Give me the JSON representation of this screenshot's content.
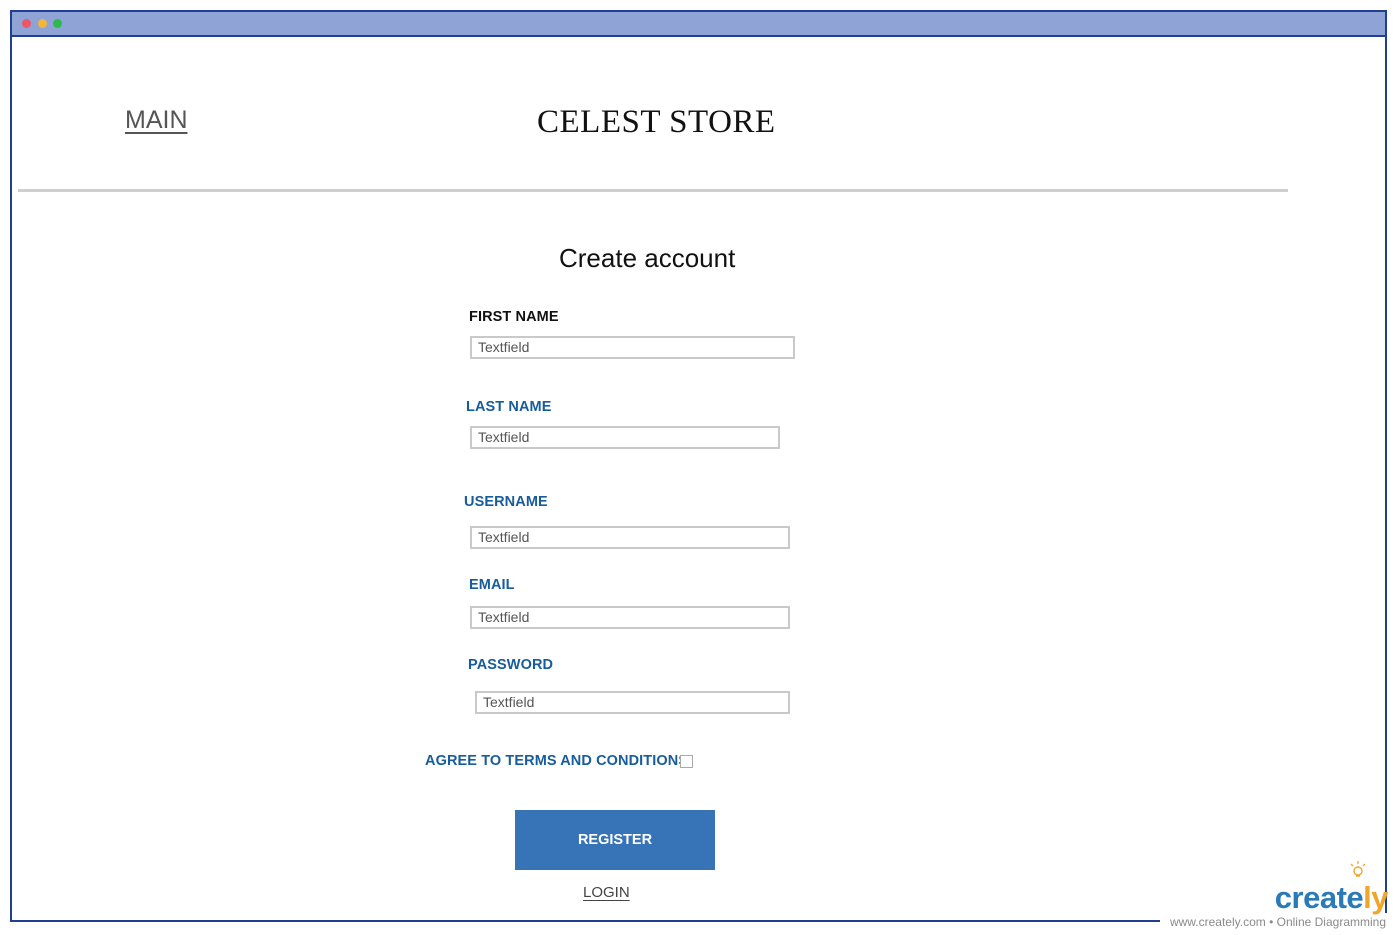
{
  "window": {
    "traffic_lights": {
      "close": "#ee5566",
      "minimize": "#f2b73a",
      "maximize": "#2db94d"
    }
  },
  "header": {
    "main_link": "MAIN",
    "store_title": "CELEST STORE"
  },
  "form": {
    "heading": "Create account",
    "fields": {
      "first_name": {
        "label": "FIRST NAME",
        "value": "Textfield"
      },
      "last_name": {
        "label": "LAST NAME",
        "value": "Textfield"
      },
      "username": {
        "label": "USERNAME",
        "value": "Textfield"
      },
      "email": {
        "label": "EMAIL",
        "value": "Textfield"
      },
      "password": {
        "label": "PASSWORD",
        "value": "Textfield"
      }
    },
    "agree_label": "AGREE TO TERMS AND CONDITIONS",
    "agree_checked": false,
    "register_label": "REGISTER",
    "login_label": "LOGIN"
  },
  "watermark": {
    "brand_main": "create",
    "brand_end": "ly",
    "footer": "www.creately.com • Online Diagramming"
  },
  "colors": {
    "accent": "#3673b7",
    "label_blue": "#175c9c",
    "titlebar": "#8fa3d6",
    "frame": "#1f3f8f"
  }
}
